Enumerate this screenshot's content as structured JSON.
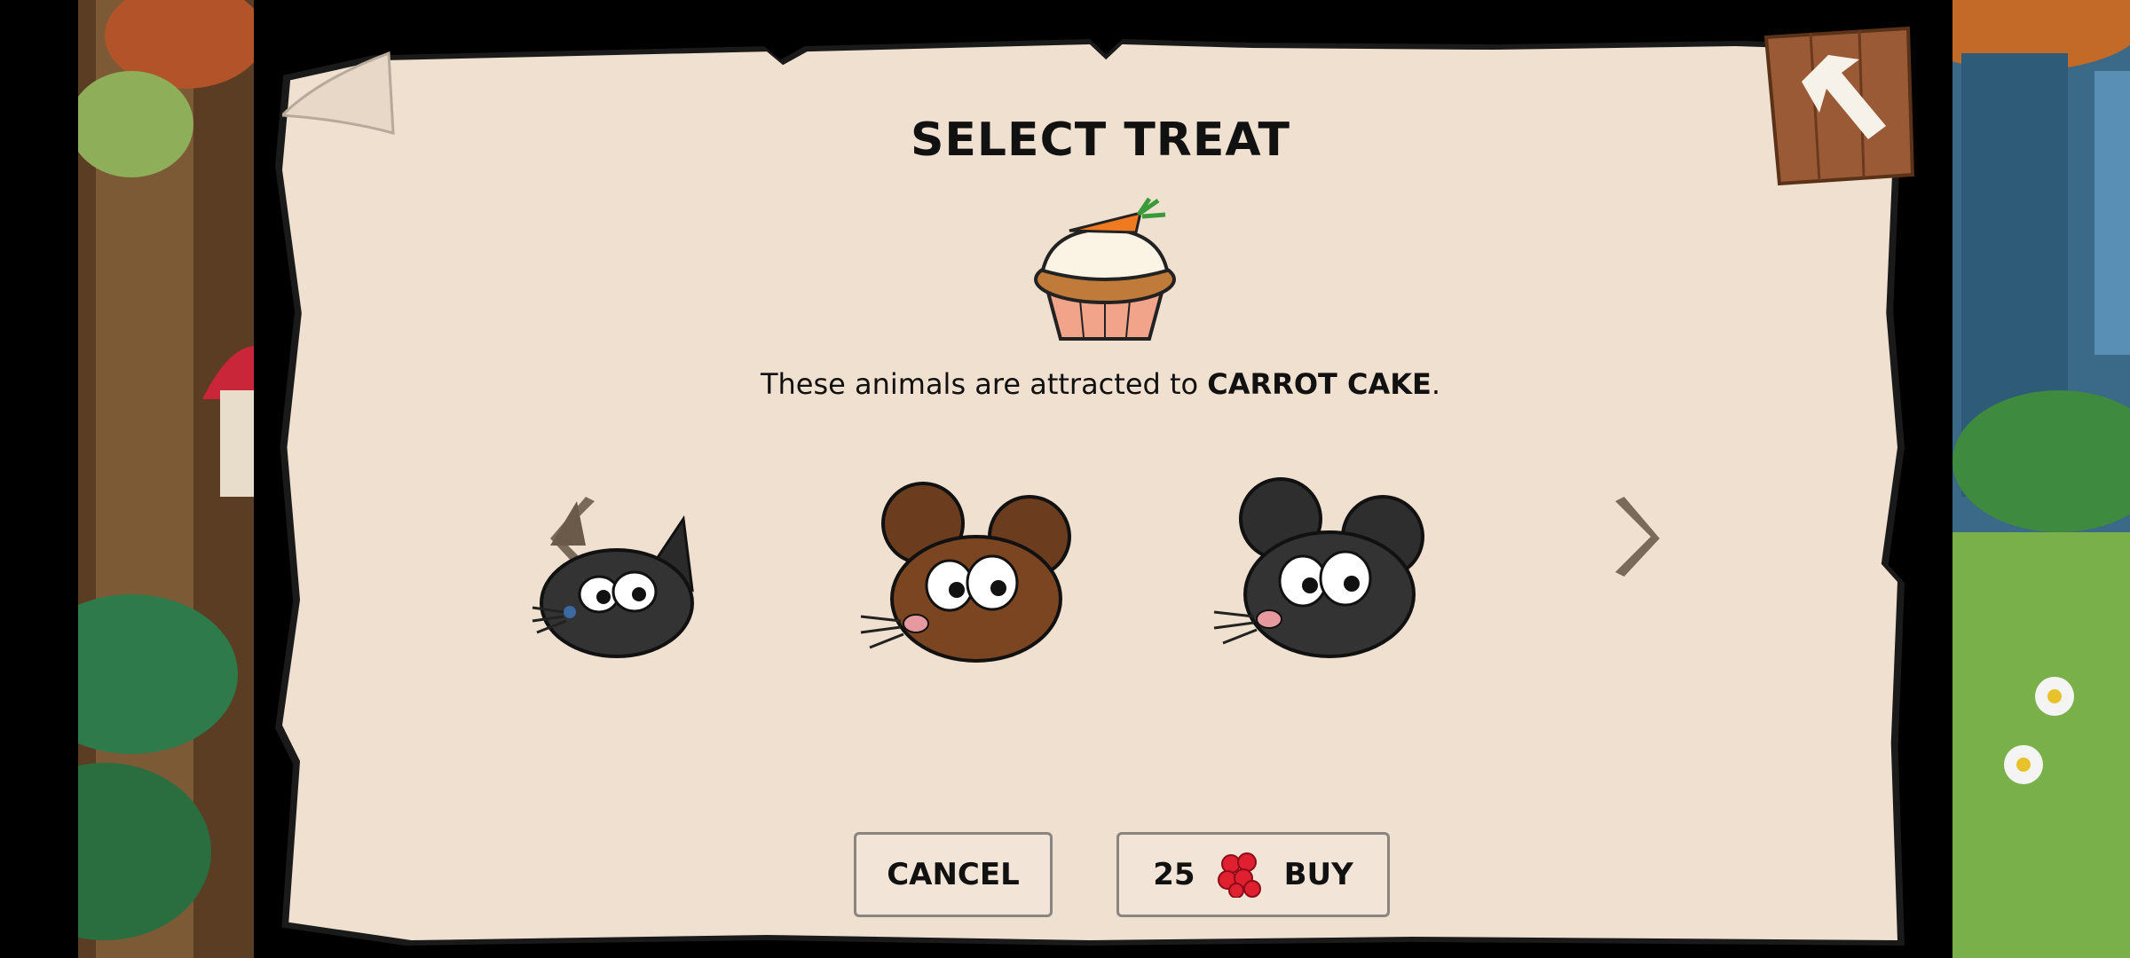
{
  "dialog": {
    "title": "SELECT TREAT",
    "description_prefix": "These animals are attracted to ",
    "treat_name": "CARROT CAKE",
    "description_suffix": ".",
    "treat_icon": "carrot-cupcake-icon"
  },
  "animals": [
    {
      "name": "squirrel-head-icon"
    },
    {
      "name": "brown-mouse-head-icon"
    },
    {
      "name": "black-mouse-head-icon"
    }
  ],
  "buttons": {
    "cancel_label": "CANCEL",
    "buy_price": "25",
    "buy_currency_icon": "red-berries-icon",
    "buy_label": "BUY"
  },
  "colors": {
    "panel": "#efe0d0",
    "text": "#111111",
    "currency": "#e02030"
  }
}
